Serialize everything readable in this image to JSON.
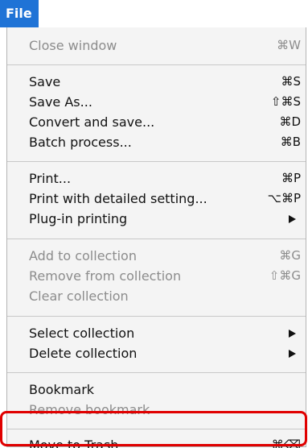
{
  "menu_title": "File",
  "menu": {
    "items": [
      {
        "label": "Close window",
        "shortcut": "⌘W"
      },
      {
        "label": "Save",
        "shortcut": "⌘S"
      },
      {
        "label": "Save As...",
        "shortcut": "⇧⌘S"
      },
      {
        "label": "Convert and save...",
        "shortcut": "⌘D"
      },
      {
        "label": "Batch process...",
        "shortcut": "⌘B"
      },
      {
        "label": "Print...",
        "shortcut": "⌘P"
      },
      {
        "label": "Print with detailed setting...",
        "shortcut": "⌥⌘P"
      },
      {
        "label": "Plug-in printing",
        "submenu_icon": "triangle-right-icon"
      },
      {
        "label": "Add to collection",
        "shortcut": "⌘G"
      },
      {
        "label": "Remove from collection",
        "shortcut": "⇧⌘G"
      },
      {
        "label": "Clear collection"
      },
      {
        "label": "Select collection",
        "submenu_icon": "triangle-right-icon"
      },
      {
        "label": "Delete collection",
        "submenu_icon": "triangle-right-icon"
      },
      {
        "label": "Bookmark"
      },
      {
        "label": "Remove bookmark"
      },
      {
        "label": "Move to Trash",
        "shortcut": "⌘⌫"
      }
    ]
  },
  "colors": {
    "menu_title_background": "#1f73d6",
    "menu_background": "#f4f4f4",
    "disabled_text": "#8c8c8c",
    "highlight_ring": "#e00000"
  }
}
